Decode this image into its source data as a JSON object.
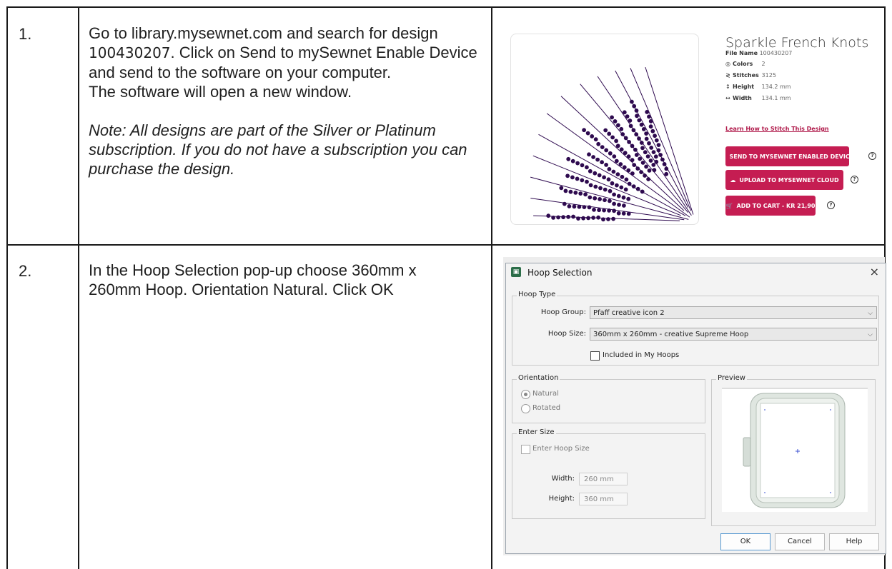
{
  "rows": [
    {
      "number": "1.",
      "text_a": "Go to library.mysewnet.com and search for design ",
      "design_number": "100430207",
      "text_b": ".  Click on Send to mySewnet Enable Device and send to the software on your computer.",
      "text_c": "The software will open a new window.",
      "note": "Note: All designs are part of the Silver or Platinum subscription. If you do not have a subscription you can purchase the design."
    },
    {
      "number": "2.",
      "text": "In the Hoop Selection pop-up choose 360mm x 260mm Hoop. Orientation Natural. Click OK"
    }
  ],
  "product": {
    "title": "Sparkle French Knots",
    "meta": [
      {
        "icon": "file-icon",
        "glyph": "",
        "key": "File Name",
        "value": "100430207"
      },
      {
        "icon": "palette-icon",
        "glyph": "◎",
        "key": "Colors",
        "value": "2"
      },
      {
        "icon": "stitches-icon",
        "glyph": "≷",
        "key": "Stitches",
        "value": "3125"
      },
      {
        "icon": "height-icon",
        "glyph": "↕",
        "key": "Height",
        "value": "134.2 mm"
      },
      {
        "icon": "width-icon",
        "glyph": "↔",
        "key": "Width",
        "value": "134.1 mm"
      }
    ],
    "learn_link": "Learn How to Stitch This Design",
    "buttons": {
      "send": "SEND TO MYSEWNET ENABLED DEVICE",
      "upload": "UPLOAD TO MYSEWNET CLOUD",
      "cart": "ADD TO CART - KR 21,90"
    },
    "accent": "#c51d52",
    "stitch_color": "#2e0a4f"
  },
  "dialog": {
    "title": "Hoop Selection",
    "close": "×",
    "hoop_type_label": "Hoop Type",
    "hoop_group_label": "Hoop Group:",
    "hoop_group_value": "Pfaff creative icon 2",
    "hoop_size_label": "Hoop Size:",
    "hoop_size_value": "360mm x 260mm - creative Supreme Hoop",
    "included_label": "Included in My Hoops",
    "orientation_label": "Orientation",
    "natural_label": "Natural",
    "rotated_label": "Rotated",
    "orientation_selected": "Natural",
    "enter_size_label": "Enter Size",
    "enter_hoop_size_label": "Enter Hoop Size",
    "width_label": "Width:",
    "width_value": "260 mm",
    "height_label": "Height:",
    "height_value": "360 mm",
    "preview_label": "Preview",
    "ok": "OK",
    "cancel": "Cancel",
    "help": "Help"
  }
}
